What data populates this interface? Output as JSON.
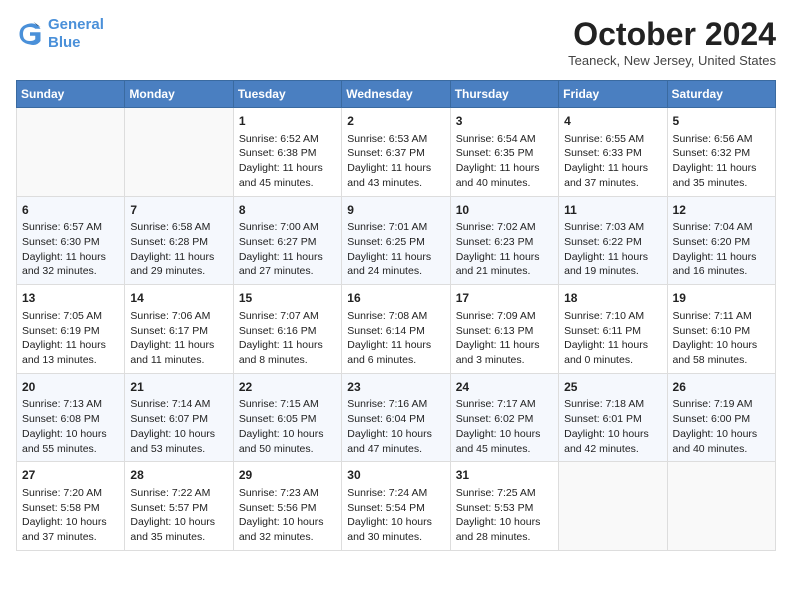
{
  "header": {
    "logo_line1": "General",
    "logo_line2": "Blue",
    "month": "October 2024",
    "location": "Teaneck, New Jersey, United States"
  },
  "days_of_week": [
    "Sunday",
    "Monday",
    "Tuesday",
    "Wednesday",
    "Thursday",
    "Friday",
    "Saturday"
  ],
  "weeks": [
    [
      {
        "day": "",
        "content": ""
      },
      {
        "day": "",
        "content": ""
      },
      {
        "day": "1",
        "content": "Sunrise: 6:52 AM\nSunset: 6:38 PM\nDaylight: 11 hours and 45 minutes."
      },
      {
        "day": "2",
        "content": "Sunrise: 6:53 AM\nSunset: 6:37 PM\nDaylight: 11 hours and 43 minutes."
      },
      {
        "day": "3",
        "content": "Sunrise: 6:54 AM\nSunset: 6:35 PM\nDaylight: 11 hours and 40 minutes."
      },
      {
        "day": "4",
        "content": "Sunrise: 6:55 AM\nSunset: 6:33 PM\nDaylight: 11 hours and 37 minutes."
      },
      {
        "day": "5",
        "content": "Sunrise: 6:56 AM\nSunset: 6:32 PM\nDaylight: 11 hours and 35 minutes."
      }
    ],
    [
      {
        "day": "6",
        "content": "Sunrise: 6:57 AM\nSunset: 6:30 PM\nDaylight: 11 hours and 32 minutes."
      },
      {
        "day": "7",
        "content": "Sunrise: 6:58 AM\nSunset: 6:28 PM\nDaylight: 11 hours and 29 minutes."
      },
      {
        "day": "8",
        "content": "Sunrise: 7:00 AM\nSunset: 6:27 PM\nDaylight: 11 hours and 27 minutes."
      },
      {
        "day": "9",
        "content": "Sunrise: 7:01 AM\nSunset: 6:25 PM\nDaylight: 11 hours and 24 minutes."
      },
      {
        "day": "10",
        "content": "Sunrise: 7:02 AM\nSunset: 6:23 PM\nDaylight: 11 hours and 21 minutes."
      },
      {
        "day": "11",
        "content": "Sunrise: 7:03 AM\nSunset: 6:22 PM\nDaylight: 11 hours and 19 minutes."
      },
      {
        "day": "12",
        "content": "Sunrise: 7:04 AM\nSunset: 6:20 PM\nDaylight: 11 hours and 16 minutes."
      }
    ],
    [
      {
        "day": "13",
        "content": "Sunrise: 7:05 AM\nSunset: 6:19 PM\nDaylight: 11 hours and 13 minutes."
      },
      {
        "day": "14",
        "content": "Sunrise: 7:06 AM\nSunset: 6:17 PM\nDaylight: 11 hours and 11 minutes."
      },
      {
        "day": "15",
        "content": "Sunrise: 7:07 AM\nSunset: 6:16 PM\nDaylight: 11 hours and 8 minutes."
      },
      {
        "day": "16",
        "content": "Sunrise: 7:08 AM\nSunset: 6:14 PM\nDaylight: 11 hours and 6 minutes."
      },
      {
        "day": "17",
        "content": "Sunrise: 7:09 AM\nSunset: 6:13 PM\nDaylight: 11 hours and 3 minutes."
      },
      {
        "day": "18",
        "content": "Sunrise: 7:10 AM\nSunset: 6:11 PM\nDaylight: 11 hours and 0 minutes."
      },
      {
        "day": "19",
        "content": "Sunrise: 7:11 AM\nSunset: 6:10 PM\nDaylight: 10 hours and 58 minutes."
      }
    ],
    [
      {
        "day": "20",
        "content": "Sunrise: 7:13 AM\nSunset: 6:08 PM\nDaylight: 10 hours and 55 minutes."
      },
      {
        "day": "21",
        "content": "Sunrise: 7:14 AM\nSunset: 6:07 PM\nDaylight: 10 hours and 53 minutes."
      },
      {
        "day": "22",
        "content": "Sunrise: 7:15 AM\nSunset: 6:05 PM\nDaylight: 10 hours and 50 minutes."
      },
      {
        "day": "23",
        "content": "Sunrise: 7:16 AM\nSunset: 6:04 PM\nDaylight: 10 hours and 47 minutes."
      },
      {
        "day": "24",
        "content": "Sunrise: 7:17 AM\nSunset: 6:02 PM\nDaylight: 10 hours and 45 minutes."
      },
      {
        "day": "25",
        "content": "Sunrise: 7:18 AM\nSunset: 6:01 PM\nDaylight: 10 hours and 42 minutes."
      },
      {
        "day": "26",
        "content": "Sunrise: 7:19 AM\nSunset: 6:00 PM\nDaylight: 10 hours and 40 minutes."
      }
    ],
    [
      {
        "day": "27",
        "content": "Sunrise: 7:20 AM\nSunset: 5:58 PM\nDaylight: 10 hours and 37 minutes."
      },
      {
        "day": "28",
        "content": "Sunrise: 7:22 AM\nSunset: 5:57 PM\nDaylight: 10 hours and 35 minutes."
      },
      {
        "day": "29",
        "content": "Sunrise: 7:23 AM\nSunset: 5:56 PM\nDaylight: 10 hours and 32 minutes."
      },
      {
        "day": "30",
        "content": "Sunrise: 7:24 AM\nSunset: 5:54 PM\nDaylight: 10 hours and 30 minutes."
      },
      {
        "day": "31",
        "content": "Sunrise: 7:25 AM\nSunset: 5:53 PM\nDaylight: 10 hours and 28 minutes."
      },
      {
        "day": "",
        "content": ""
      },
      {
        "day": "",
        "content": ""
      }
    ]
  ]
}
